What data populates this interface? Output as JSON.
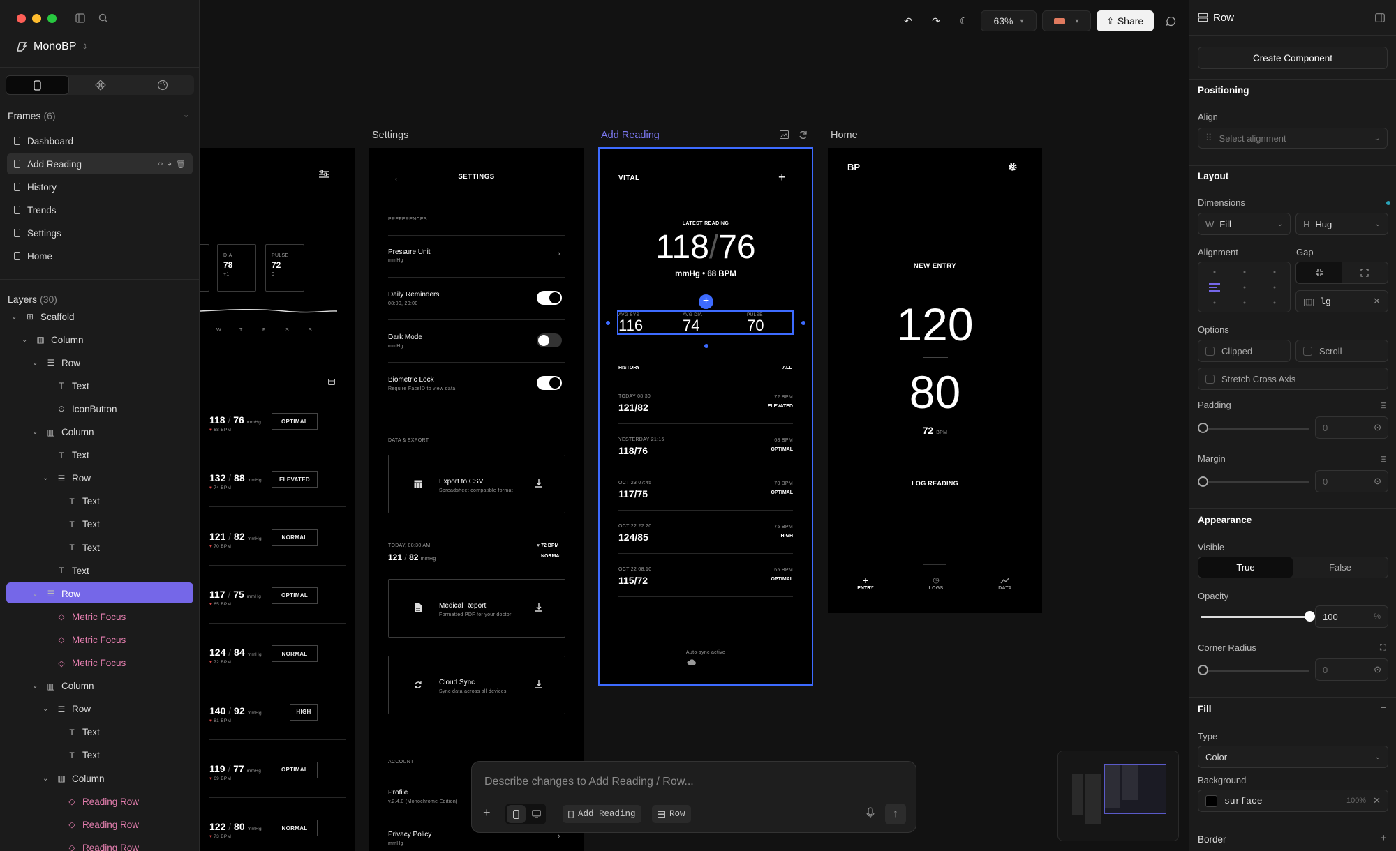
{
  "window": {
    "project": "MonoBP"
  },
  "frames": {
    "title": "Frames",
    "count": "(6)",
    "items": [
      {
        "label": "Dashboard"
      },
      {
        "label": "Add Reading"
      },
      {
        "label": "History"
      },
      {
        "label": "Trends"
      },
      {
        "label": "Settings"
      },
      {
        "label": "Home"
      }
    ]
  },
  "layers": {
    "title": "Layers",
    "count": "(30)",
    "items": [
      {
        "label": "Scaffold",
        "icon": "scaffold-icon"
      },
      {
        "label": "Column",
        "icon": "column-icon"
      },
      {
        "label": "Row",
        "icon": "row-icon"
      },
      {
        "label": "Text",
        "icon": "text-icon"
      },
      {
        "label": "IconButton",
        "icon": "iconbutton-icon"
      },
      {
        "label": "Column",
        "icon": "column-icon"
      },
      {
        "label": "Text",
        "icon": "text-icon"
      },
      {
        "label": "Row",
        "icon": "row-icon"
      },
      {
        "label": "Text",
        "icon": "text-icon"
      },
      {
        "label": "Text",
        "icon": "text-icon"
      },
      {
        "label": "Text",
        "icon": "text-icon"
      },
      {
        "label": "Text",
        "icon": "text-icon"
      },
      {
        "label": "Row",
        "icon": "row-icon"
      },
      {
        "label": "Metric Focus",
        "icon": "component-icon"
      },
      {
        "label": "Metric Focus",
        "icon": "component-icon"
      },
      {
        "label": "Metric Focus",
        "icon": "component-icon"
      },
      {
        "label": "Column",
        "icon": "column-icon"
      },
      {
        "label": "Row",
        "icon": "row-icon"
      },
      {
        "label": "Text",
        "icon": "text-icon"
      },
      {
        "label": "Text",
        "icon": "text-icon"
      },
      {
        "label": "Column",
        "icon": "column-icon"
      },
      {
        "label": "Reading Row",
        "icon": "component-icon"
      },
      {
        "label": "Reading Row",
        "icon": "component-icon"
      },
      {
        "label": "Reading Row",
        "icon": "component-icon"
      }
    ]
  },
  "toolbar": {
    "zoom": "63%",
    "share": "Share"
  },
  "canvas_labels": {
    "settings": "Settings",
    "add_reading": "Add Reading",
    "home": "Home"
  },
  "dashboard": {
    "metrics": [
      {
        "label": "DIA",
        "value": "78",
        "delta": "+1"
      },
      {
        "label": "PULSE",
        "value": "72",
        "delta": "0"
      }
    ],
    "days": [
      "W",
      "T",
      "F",
      "S",
      "S"
    ],
    "rows": [
      {
        "sys": "118",
        "dia": "76",
        "unit": "mmHg",
        "bpm": "68 BPM",
        "status": "OPTIMAL"
      },
      {
        "sys": "132",
        "dia": "88",
        "unit": "mmHg",
        "bpm": "74 BPM",
        "status": "ELEVATED"
      },
      {
        "sys": "121",
        "dia": "82",
        "unit": "mmHg",
        "bpm": "70 BPM",
        "status": "NORMAL"
      },
      {
        "sys": "117",
        "dia": "75",
        "unit": "mmHg",
        "bpm": "65 BPM",
        "status": "OPTIMAL"
      },
      {
        "sys": "124",
        "dia": "84",
        "unit": "mmHg",
        "bpm": "72 BPM",
        "status": "NORMAL"
      },
      {
        "sys": "140",
        "dia": "92",
        "unit": "mmHg",
        "bpm": "81 BPM",
        "status": "HIGH"
      },
      {
        "sys": "119",
        "dia": "77",
        "unit": "mmHg",
        "bpm": "69 BPM",
        "status": "OPTIMAL"
      },
      {
        "sys": "122",
        "dia": "80",
        "unit": "mmHg",
        "bpm": "73 BPM",
        "status": "NORMAL"
      }
    ]
  },
  "settings": {
    "title": "SETTINGS",
    "preferences": "PREFERENCES",
    "pressure_unit": "Pressure Unit",
    "pressure_unit_sub": "mmHg",
    "daily_reminders": "Daily Reminders",
    "daily_reminders_sub": "08:00, 20:00",
    "dark_mode": "Dark Mode",
    "dark_mode_sub": "mmHg",
    "biometric": "Biometric Lock",
    "biometric_sub": "Require FaceID to view data",
    "toggles": {
      "daily_reminders": true,
      "dark_mode": false,
      "biometric": true
    },
    "data_export": "DATA & EXPORT",
    "export_csv": "Export to CSV",
    "export_csv_sub": "Spreadsheet compatible format",
    "reading_time": "TODAY, 08:30 AM",
    "reading_sys": "121",
    "reading_dia": "82",
    "reading_unit": "mmHg",
    "reading_bpm": "72 BPM",
    "reading_status": "NORMAL",
    "medical_report": "Medical Report",
    "medical_report_sub": "Formatted PDF for your doctor",
    "cloud_sync": "Cloud Sync",
    "cloud_sync_sub": "Sync data across all devices",
    "account": "ACCOUNT",
    "profile": "Profile",
    "profile_sub": "v.2.4.0 (Monochrome Edition)",
    "privacy": "Privacy Policy",
    "privacy_sub": "mmHg"
  },
  "add_reading": {
    "brand": "VITAL",
    "latest": "LATEST READING",
    "sys": "118",
    "dia": "76",
    "sub": "mmHg • 68 BPM",
    "metrics": [
      {
        "label": "AVG SYS",
        "value": "116"
      },
      {
        "label": "AVG DIA",
        "value": "74"
      },
      {
        "label": "PULSE",
        "value": "70"
      }
    ],
    "history": "HISTORY",
    "all": "ALL",
    "rows": [
      {
        "time": "TODAY 08:30",
        "value": "121/82",
        "bpm": "72 BPM",
        "status": "ELEVATED"
      },
      {
        "time": "YESTERDAY 21:15",
        "value": "118/76",
        "bpm": "68 BPM",
        "status": "OPTIMAL"
      },
      {
        "time": "OCT 23 07:45",
        "value": "117/75",
        "bpm": "70 BPM",
        "status": "OPTIMAL"
      },
      {
        "time": "OCT 22 22:20",
        "value": "124/85",
        "bpm": "75 BPM",
        "status": "HIGH"
      },
      {
        "time": "OCT 22 08:10",
        "value": "115/72",
        "bpm": "65 BPM",
        "status": "OPTIMAL"
      }
    ],
    "sync": "Auto-sync active"
  },
  "home": {
    "brand": "BP",
    "new_entry": "NEW ENTRY",
    "sys": "120",
    "dia": "80",
    "pulse": "72",
    "pulse_unit": "BPM",
    "log": "LOG READING",
    "nav": [
      "ENTRY",
      "LOGS",
      "DATA"
    ]
  },
  "prompt": {
    "placeholder": "Describe changes to Add Reading / Row...",
    "chip_frame": "Add Reading",
    "chip_layer": "Row"
  },
  "inspector": {
    "title": "Row",
    "create_component": "Create Component",
    "positioning": "Positioning",
    "align": "Align",
    "align_placeholder": "Select alignment",
    "layout": "Layout",
    "dimensions": "Dimensions",
    "w_label": "W",
    "w_value": "Fill",
    "h_label": "H",
    "h_value": "Hug",
    "alignment": "Alignment",
    "gap": "Gap",
    "gap_value": "lg",
    "options": "Options",
    "clipped": "Clipped",
    "scroll": "Scroll",
    "stretch": "Stretch Cross Axis",
    "padding": "Padding",
    "padding_value": "0",
    "margin": "Margin",
    "margin_value": "0",
    "appearance": "Appearance",
    "visible": "Visible",
    "visible_true": "True",
    "visible_false": "False",
    "opacity": "Opacity",
    "opacity_value": "100",
    "opacity_unit": "%",
    "corner_radius": "Corner Radius",
    "corner_value": "0",
    "fill": "Fill",
    "type": "Type",
    "type_value": "Color",
    "background": "Background",
    "bg_value": "surface",
    "bg_opacity": "100%",
    "border": "Border"
  },
  "colors": {
    "accent": "#7567e8",
    "selection": "#3d6bff",
    "canvas": "#121212",
    "panel": "#1b1b1b"
  }
}
